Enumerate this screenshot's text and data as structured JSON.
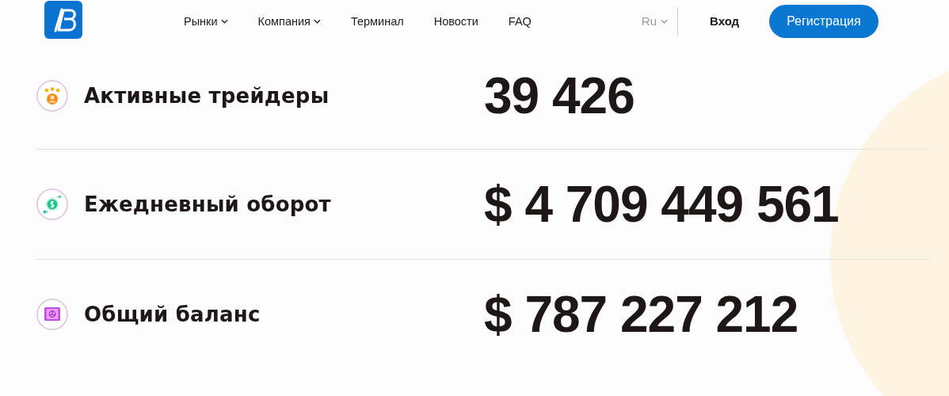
{
  "nav": {
    "items": [
      {
        "label": "Рынки",
        "kind": "dropdown"
      },
      {
        "label": "Компания",
        "kind": "dropdown"
      },
      {
        "label": "Терминал",
        "kind": "link"
      },
      {
        "label": "Новости",
        "kind": "link"
      },
      {
        "label": "FAQ",
        "kind": "link"
      }
    ],
    "language": "Ru",
    "login": "Вход",
    "register": "Регистрация"
  },
  "stats": [
    {
      "kind": "trader",
      "label": "Активные трейдеры",
      "value": "39 426"
    },
    {
      "kind": "money",
      "label": "Ежедневный оборот",
      "value": "$ 4 709 449 561"
    },
    {
      "kind": "safe",
      "label": "Общий баланс",
      "value": "$ 787 227 212"
    }
  ]
}
